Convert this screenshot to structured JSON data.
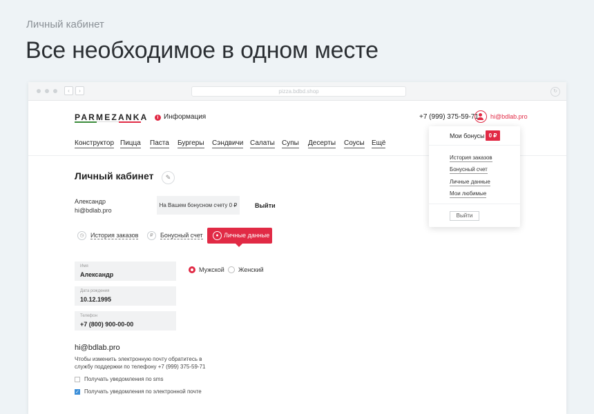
{
  "caption": "Личный кабинет",
  "headline": "Все необходимое в одном месте",
  "browser": {
    "url": "pizza.bdbd.shop"
  },
  "brand": {
    "logo": "PARMEZANKA",
    "flag_colors": [
      "#3a8a3a",
      "#ffffff",
      "#e12a45"
    ]
  },
  "header": {
    "info_link": "Информация",
    "phone": "+7 (999) 375-59-71",
    "user_email": "hi@bdlab.pro"
  },
  "menu": [
    "Конструктор",
    "Пицца",
    "Паста",
    "Бургеры",
    "Сэндвичи",
    "Салаты",
    "Супы",
    "Десерты",
    "Соусы",
    "Ещё"
  ],
  "dropdown": {
    "title": "Мои бонусы",
    "badge": "0 ₽",
    "items": [
      "История заказов",
      "Бонусный счет",
      "Личные данные",
      "Мои любимые"
    ],
    "logout": "Выйти"
  },
  "account": {
    "title": "Личный кабинет",
    "name": "Александр",
    "email": "hi@bdlab.pro",
    "bonus_text": "На Вашем бонусном счету 0 ₽",
    "exit_label": "Выйти"
  },
  "tabs": [
    {
      "label": "История заказов",
      "icon": "clock-icon"
    },
    {
      "label": "Бонусный счет",
      "icon": "ruble-icon"
    },
    {
      "label": "Личные данные",
      "icon": "user-icon",
      "active": true
    }
  ],
  "form": {
    "fields": [
      {
        "label": "Имя",
        "value": "Александр"
      },
      {
        "label": "Дата рождения",
        "value": "10.12.1995"
      },
      {
        "label": "Телефон",
        "value": "+7 (800) 900-00-00"
      }
    ],
    "gender": [
      {
        "label": "Мужской",
        "selected": true
      },
      {
        "label": "Женский",
        "selected": false
      }
    ],
    "email": "hi@bdlab.pro",
    "email_note": "Чтобы изменить электронную почту обратитесь в службу поддержки по телефону +7 (999) 375-59-71",
    "checkboxes": [
      {
        "label": "Получать уведомления по sms",
        "checked": false
      },
      {
        "label": "Получать уведомления по электронной почте",
        "checked": true
      }
    ]
  },
  "colors": {
    "accent": "#e12a45",
    "checkbox": "#3b8ed8"
  }
}
